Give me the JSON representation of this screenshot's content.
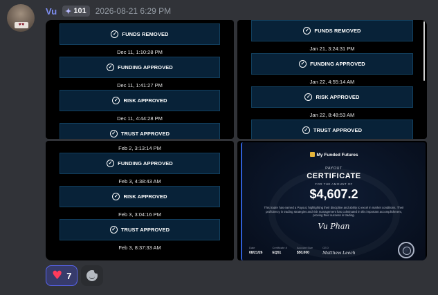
{
  "message": {
    "author": "Vu",
    "role_tag": "101",
    "timestamp": "2026-08-21 6:29 PM"
  },
  "attachments": {
    "tile1": {
      "items": [
        {
          "type": "status",
          "label": "FUNDS REMOVED"
        },
        {
          "type": "time",
          "label": "Dec 11, 1:10:28 PM"
        },
        {
          "type": "status",
          "label": "FUNDING APPROVED"
        },
        {
          "type": "time",
          "label": "Dec 11, 1:41:27 PM"
        },
        {
          "type": "status",
          "label": "RISK APPROVED"
        },
        {
          "type": "time",
          "label": "Dec 11, 4:44:28 PM"
        },
        {
          "type": "status",
          "label": "TRUST APPROVED"
        }
      ]
    },
    "tile2": {
      "items": [
        {
          "type": "status",
          "label": "FUNDS REMOVED"
        },
        {
          "type": "time",
          "label": "Jan 21, 3:24:31 PM"
        },
        {
          "type": "status",
          "label": "FUNDING APPROVED"
        },
        {
          "type": "time",
          "label": "Jan 22, 4:55:14 AM"
        },
        {
          "type": "status",
          "label": "RISK APPROVED"
        },
        {
          "type": "time",
          "label": "Jan 22, 8:48:53 AM"
        },
        {
          "type": "status",
          "label": "TRUST APPROVED"
        }
      ]
    },
    "tile3": {
      "items": [
        {
          "type": "time",
          "label": "Feb 2, 3:13:14 PM"
        },
        {
          "type": "status",
          "label": "FUNDING APPROVED"
        },
        {
          "type": "time",
          "label": "Feb 3, 4:38:43 AM"
        },
        {
          "type": "status",
          "label": "RISK APPROVED"
        },
        {
          "type": "time",
          "label": "Feb 3, 3:04:16 PM"
        },
        {
          "type": "status",
          "label": "TRUST APPROVED"
        },
        {
          "type": "time",
          "label": "Feb 3, 8:37:33 AM"
        }
      ]
    },
    "certificate": {
      "brand": "My Funded Futures",
      "payout_label": "PAYOUT",
      "title": "CERTIFICATE",
      "for_amount": "FOR THE AMOUNT OF",
      "amount": "$4,607.2",
      "description": "This trader has earned a Payout, highlighting their discipline and ability to excel in market conditions. Their proficiency in trading strategies and risk management has culminated in this important accomplishment, proving their success in trading.",
      "recipient": "Vu Phan",
      "footer": [
        {
          "label": "Date",
          "value": "08/21/26"
        },
        {
          "label": "Certificate #",
          "value": "EQ51"
        },
        {
          "label": "Account Size",
          "value": "$50,000"
        },
        {
          "label": "CEO",
          "value": "Matthew Leech"
        }
      ]
    }
  },
  "reactions": [
    {
      "emoji": "heart",
      "count": "7"
    }
  ],
  "icons": {
    "status_check": "check-circle-icon",
    "reaction": "red-heart-icon",
    "add_reaction": "add-reaction-icon"
  },
  "colors": {
    "background": "#313338",
    "username": "#7e8ef1",
    "status_box": "#082238",
    "reaction_border": "#5865f2"
  }
}
